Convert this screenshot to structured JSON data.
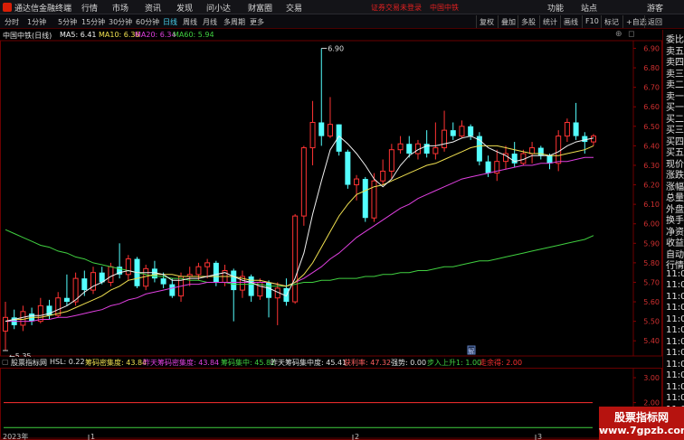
{
  "menu": {
    "app_title": "通达信金融终端",
    "items": [
      "行情",
      "市场",
      "资讯",
      "发现",
      "问小达",
      "财富圈",
      "交易"
    ],
    "notice": "证券交易未登录",
    "stock_name": "中国中铁",
    "right_items": [
      "功能",
      "站点",
      "游客"
    ]
  },
  "toolbar": {
    "periods": [
      "分时",
      "1分钟",
      "5分钟",
      "15分钟",
      "30分钟",
      "60分钟",
      "日线",
      "周线",
      "月线",
      "多周期",
      "更多"
    ],
    "active_period": "日线",
    "buttons": [
      "复权",
      "叠加",
      "多股",
      "统计",
      "画线",
      "F10",
      "标记",
      "+自选",
      "返回"
    ]
  },
  "chart_header": {
    "title": "中国中铁(日线)",
    "ma5": "MA5: 6.41",
    "ma10": "MA10: 6.36",
    "ma20": "MA20: 6.34",
    "ma60": "MA60: 5.94"
  },
  "annotations": {
    "high": "6.90",
    "low": "5.35",
    "flag": "解"
  },
  "sub_header": {
    "title": "股票指标网",
    "hsl": "HSL: 0.22",
    "chip_density": "筹码密集度: 43.84",
    "prev_chip_density": "昨天筹码密集度: 43.84",
    "chip_concentration": "筹码集中: 45.82",
    "prev_chip_concentration": "昨天筹码集中度: 45.41",
    "profit_ratio": "获利率: 47.32",
    "strength": "强势: 0.00",
    "uptrend": "步入上升1: 1.00",
    "strong_hold": "走余得: 2.00"
  },
  "side_panel": {
    "items": [
      "委比",
      "卖五",
      "卖四",
      "卖三",
      "卖二",
      "卖一",
      "买一",
      "买二",
      "买三",
      "买四",
      "买五",
      "现价",
      "涨跌",
      "涨幅",
      "总量",
      "外盘",
      "换手",
      "净资",
      "收益",
      "自动",
      "行情",
      "11:0",
      "11:0",
      "11:0",
      "11:0",
      "11:0",
      "11:0",
      "11:0",
      "11:0",
      "11:0",
      "11:0",
      "11:0",
      "11:0",
      "11:0",
      "11:0",
      "11:0"
    ]
  },
  "date_axis": {
    "year": "2023年",
    "months": [
      "1",
      "2",
      "3"
    ]
  },
  "watermark": {
    "line1": "股票指标网",
    "line2": "www.7gpzb.com"
  },
  "colors": {
    "up": "#ff3333",
    "down": "#54ffff",
    "ma5": "#f0f0f0",
    "ma10": "#f0e050",
    "ma20": "#e040e0",
    "ma60": "#40d040"
  },
  "chart_data": {
    "type": "candlestick",
    "y_axis_ticks": [
      "6.90",
      "6.80",
      "6.70",
      "6.60",
      "6.50",
      "6.40",
      "6.30",
      "6.20",
      "6.10",
      "6.00",
      "5.90",
      "5.80",
      "5.70",
      "5.60",
      "5.50",
      "5.40"
    ],
    "ylim": [
      5.35,
      6.93
    ],
    "candles": [
      [
        5.45,
        5.52,
        5.6,
        5.35
      ],
      [
        5.52,
        5.48,
        5.56,
        5.46
      ],
      [
        5.48,
        5.55,
        5.58,
        5.45
      ],
      [
        5.54,
        5.5,
        5.57,
        5.48
      ],
      [
        5.5,
        5.58,
        5.62,
        5.49
      ],
      [
        5.58,
        5.53,
        5.61,
        5.51
      ],
      [
        5.53,
        5.62,
        5.65,
        5.52
      ],
      [
        5.62,
        5.6,
        5.74,
        5.58
      ],
      [
        5.6,
        5.72,
        5.75,
        5.58
      ],
      [
        5.72,
        5.66,
        5.76,
        5.63
      ],
      [
        5.66,
        5.75,
        5.78,
        5.64
      ],
      [
        5.75,
        5.7,
        5.78,
        5.69
      ],
      [
        5.7,
        5.78,
        5.8,
        5.68
      ],
      [
        5.78,
        5.74,
        5.9,
        5.72
      ],
      [
        5.74,
        5.82,
        5.84,
        5.71
      ],
      [
        5.82,
        5.68,
        5.83,
        5.67
      ],
      [
        5.68,
        5.77,
        5.79,
        5.66
      ],
      [
        5.77,
        5.72,
        5.81,
        5.7
      ],
      [
        5.72,
        5.69,
        5.75,
        5.67
      ],
      [
        5.69,
        5.63,
        5.72,
        5.62
      ],
      [
        5.63,
        5.73,
        5.75,
        5.6
      ],
      [
        5.73,
        5.74,
        5.78,
        5.68
      ],
      [
        5.74,
        5.78,
        5.8,
        5.71
      ],
      [
        5.78,
        5.8,
        5.82,
        5.72
      ],
      [
        5.8,
        5.7,
        5.81,
        5.68
      ],
      [
        5.7,
        5.76,
        5.79,
        5.68
      ],
      [
        5.76,
        5.66,
        5.77,
        5.5
      ],
      [
        5.66,
        5.73,
        5.76,
        5.62
      ],
      [
        5.73,
        5.63,
        5.74,
        5.6
      ],
      [
        5.63,
        5.7,
        5.72,
        5.61
      ],
      [
        5.7,
        5.62,
        5.71,
        5.52
      ],
      [
        5.62,
        5.67,
        5.7,
        5.48
      ],
      [
        5.67,
        5.6,
        5.72,
        5.58
      ],
      [
        5.6,
        6.04,
        6.05,
        5.59
      ],
      [
        6.04,
        6.39,
        6.4,
        5.99
      ],
      [
        6.39,
        6.52,
        6.63,
        6.3
      ],
      [
        6.52,
        6.45,
        6.9,
        6.4
      ],
      [
        6.45,
        6.51,
        6.65,
        6.44
      ],
      [
        6.51,
        6.37,
        6.51,
        6.35
      ],
      [
        6.37,
        6.2,
        6.38,
        6.18
      ],
      [
        6.2,
        6.23,
        6.25,
        6.12
      ],
      [
        6.23,
        6.03,
        6.24,
        6.01
      ],
      [
        6.03,
        6.22,
        6.26,
        6.01
      ],
      [
        6.22,
        6.27,
        6.33,
        6.2
      ],
      [
        6.27,
        6.38,
        6.41,
        6.23
      ],
      [
        6.38,
        6.41,
        6.45,
        6.36
      ],
      [
        6.41,
        6.36,
        6.45,
        6.34
      ],
      [
        6.36,
        6.41,
        6.43,
        6.33
      ],
      [
        6.41,
        6.36,
        6.48,
        6.34
      ],
      [
        6.36,
        6.39,
        6.52,
        6.33
      ],
      [
        6.39,
        6.48,
        6.58,
        6.37
      ],
      [
        6.48,
        6.45,
        6.52,
        6.43
      ],
      [
        6.45,
        6.5,
        6.53,
        6.44
      ],
      [
        6.5,
        6.45,
        6.51,
        6.43
      ],
      [
        6.45,
        6.32,
        6.47,
        6.3
      ],
      [
        6.32,
        6.26,
        6.35,
        6.24
      ],
      [
        6.26,
        6.32,
        6.38,
        6.22
      ],
      [
        6.32,
        6.36,
        6.4,
        6.28
      ],
      [
        6.36,
        6.31,
        6.42,
        6.29
      ],
      [
        6.31,
        6.36,
        6.38,
        6.3
      ],
      [
        6.36,
        6.39,
        6.42,
        6.31
      ],
      [
        6.39,
        6.35,
        6.4,
        6.33
      ],
      [
        6.35,
        6.31,
        6.36,
        6.28
      ],
      [
        6.31,
        6.45,
        6.48,
        6.27
      ],
      [
        6.45,
        6.52,
        6.54,
        6.42
      ],
      [
        6.52,
        6.45,
        6.62,
        6.43
      ],
      [
        6.45,
        6.42,
        6.47,
        6.36
      ],
      [
        6.42,
        6.45,
        6.46,
        6.4
      ]
    ],
    "ma5": [
      5.5,
      5.51,
      5.52,
      5.53,
      5.53,
      5.54,
      5.56,
      5.58,
      5.61,
      5.65,
      5.68,
      5.7,
      5.73,
      5.75,
      5.76,
      5.75,
      5.75,
      5.75,
      5.74,
      5.71,
      5.71,
      5.72,
      5.72,
      5.73,
      5.74,
      5.75,
      5.73,
      5.71,
      5.7,
      5.68,
      5.67,
      5.65,
      5.63,
      5.72,
      5.85,
      6.05,
      6.22,
      6.38,
      6.45,
      6.41,
      6.36,
      6.3,
      6.23,
      6.19,
      6.23,
      6.3,
      6.35,
      6.38,
      6.4,
      6.4,
      6.41,
      6.42,
      6.44,
      6.45,
      6.43,
      6.39,
      6.37,
      6.35,
      6.32,
      6.33,
      6.35,
      6.35,
      6.35,
      6.37,
      6.4,
      6.42,
      6.43,
      6.44
    ],
    "ma10": [
      5.5,
      5.51,
      5.51,
      5.52,
      5.52,
      5.53,
      5.54,
      5.55,
      5.57,
      5.59,
      5.61,
      5.63,
      5.66,
      5.68,
      5.71,
      5.72,
      5.73,
      5.74,
      5.74,
      5.74,
      5.73,
      5.73,
      5.73,
      5.73,
      5.73,
      5.73,
      5.73,
      5.72,
      5.71,
      5.71,
      5.7,
      5.69,
      5.68,
      5.7,
      5.74,
      5.8,
      5.88,
      5.96,
      6.04,
      6.1,
      6.15,
      6.17,
      6.19,
      6.2,
      6.22,
      6.24,
      6.26,
      6.28,
      6.3,
      6.31,
      6.33,
      6.35,
      6.37,
      6.39,
      6.4,
      6.4,
      6.4,
      6.39,
      6.38,
      6.37,
      6.36,
      6.36,
      6.35,
      6.35,
      6.36,
      6.37,
      6.38,
      6.4
    ],
    "ma20": [
      5.5,
      5.5,
      5.5,
      5.5,
      5.51,
      5.51,
      5.52,
      5.52,
      5.53,
      5.54,
      5.55,
      5.56,
      5.58,
      5.59,
      5.61,
      5.62,
      5.64,
      5.65,
      5.66,
      5.67,
      5.68,
      5.69,
      5.69,
      5.7,
      5.7,
      5.7,
      5.7,
      5.7,
      5.7,
      5.7,
      5.7,
      5.69,
      5.68,
      5.7,
      5.72,
      5.75,
      5.78,
      5.82,
      5.85,
      5.89,
      5.93,
      5.96,
      5.99,
      6.02,
      6.05,
      6.08,
      6.1,
      6.13,
      6.15,
      6.17,
      6.19,
      6.21,
      6.23,
      6.24,
      6.25,
      6.26,
      6.27,
      6.28,
      6.29,
      6.3,
      6.3,
      6.31,
      6.31,
      6.32,
      6.32,
      6.33,
      6.34,
      6.34
    ],
    "ma60": [
      5.97,
      5.95,
      5.93,
      5.91,
      5.89,
      5.88,
      5.86,
      5.85,
      5.83,
      5.82,
      5.8,
      5.79,
      5.78,
      5.77,
      5.76,
      5.75,
      5.74,
      5.73,
      5.73,
      5.72,
      5.72,
      5.71,
      5.71,
      5.7,
      5.7,
      5.7,
      5.69,
      5.69,
      5.69,
      5.69,
      5.68,
      5.68,
      5.68,
      5.69,
      5.7,
      5.7,
      5.71,
      5.71,
      5.72,
      5.72,
      5.72,
      5.73,
      5.73,
      5.74,
      5.74,
      5.75,
      5.75,
      5.76,
      5.76,
      5.77,
      5.78,
      5.78,
      5.79,
      5.8,
      5.81,
      5.81,
      5.82,
      5.83,
      5.84,
      5.85,
      5.86,
      5.87,
      5.88,
      5.89,
      5.9,
      5.91,
      5.92,
      5.94
    ],
    "sub_chart": {
      "y_axis_ticks": [
        "3.00",
        "2.00",
        "1.00"
      ],
      "levels": [
        {
          "name": "步入上升1",
          "value": 1.0,
          "color": "#40d040"
        },
        {
          "name": "走余得",
          "value": 2.0,
          "color": "#ff3030"
        }
      ],
      "ylim": [
        0.5,
        3.4
      ]
    }
  }
}
